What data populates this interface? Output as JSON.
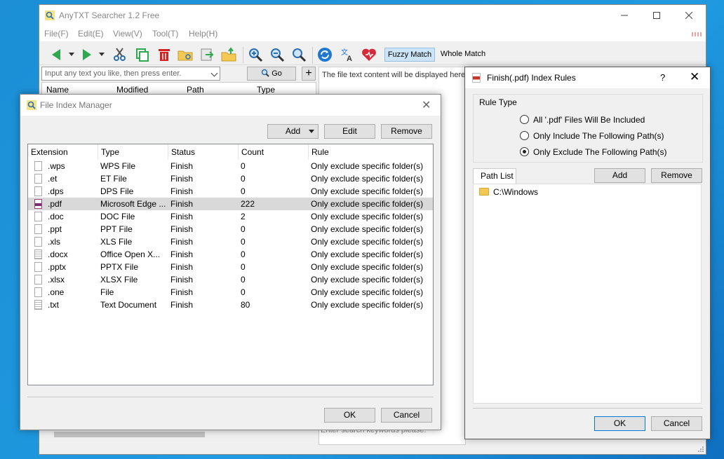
{
  "main": {
    "title": "AnyTXT Searcher 1.2 Free",
    "menu": [
      "File(F)",
      "Edit(E)",
      "View(V)",
      "Tool(T)",
      "Help(H)"
    ],
    "toolbar": {
      "fuzzy_label": "Fuzzy Match",
      "whole_label": "Whole Match"
    },
    "search": {
      "placeholder": "Input any text you like, then press enter.",
      "go_label": "Go",
      "plus_label": "+"
    },
    "results_columns": [
      "Name",
      "Modified",
      "Path",
      "Type"
    ],
    "preview_text": "The file text content will be displayed here",
    "keyword_placeholder": "Enter search keywords please."
  },
  "file_index_manager": {
    "title": "File Index Manager",
    "buttons": {
      "add": "Add",
      "edit": "Edit",
      "remove": "Remove",
      "ok": "OK",
      "cancel": "Cancel"
    },
    "columns": [
      "Extension",
      "Type",
      "Status",
      "Count",
      "Rule"
    ],
    "rows": [
      {
        "ext": ".wps",
        "type": "WPS File",
        "status": "Finish",
        "count": "0",
        "rule": "Only exclude specific folder(s)",
        "icon": "blank"
      },
      {
        "ext": ".et",
        "type": "ET File",
        "status": "Finish",
        "count": "0",
        "rule": "Only exclude specific folder(s)",
        "icon": "blank"
      },
      {
        "ext": ".dps",
        "type": "DPS File",
        "status": "Finish",
        "count": "0",
        "rule": "Only exclude specific folder(s)",
        "icon": "blank"
      },
      {
        "ext": ".pdf",
        "type": "Microsoft Edge ...",
        "status": "Finish",
        "count": "222",
        "rule": "Only exclude specific folder(s)",
        "icon": "pdf",
        "selected": true
      },
      {
        "ext": ".doc",
        "type": "DOC File",
        "status": "Finish",
        "count": "2",
        "rule": "Only exclude specific folder(s)",
        "icon": "blank"
      },
      {
        "ext": ".ppt",
        "type": "PPT File",
        "status": "Finish",
        "count": "0",
        "rule": "Only exclude specific folder(s)",
        "icon": "blank"
      },
      {
        "ext": ".xls",
        "type": "XLS File",
        "status": "Finish",
        "count": "0",
        "rule": "Only exclude specific folder(s)",
        "icon": "blank"
      },
      {
        "ext": ".docx",
        "type": "Office Open X...",
        "status": "Finish",
        "count": "0",
        "rule": "Only exclude specific folder(s)",
        "icon": "lined"
      },
      {
        "ext": ".pptx",
        "type": "PPTX File",
        "status": "Finish",
        "count": "0",
        "rule": "Only exclude specific folder(s)",
        "icon": "blank"
      },
      {
        "ext": ".xlsx",
        "type": "XLSX File",
        "status": "Finish",
        "count": "0",
        "rule": "Only exclude specific folder(s)",
        "icon": "blank"
      },
      {
        "ext": ".one",
        "type": "File",
        "status": "Finish",
        "count": "0",
        "rule": "Only exclude specific folder(s)",
        "icon": "blank"
      },
      {
        "ext": ".txt",
        "type": "Text Document",
        "status": "Finish",
        "count": "80",
        "rule": "Only exclude specific folder(s)",
        "icon": "lined"
      }
    ]
  },
  "index_rules": {
    "title": "Finish(.pdf) Index Rules",
    "help": "?",
    "rule_type_label": "Rule Type",
    "options": [
      {
        "label": "All '.pdf' Files Will Be Included",
        "checked": false
      },
      {
        "label": "Only Include The Following Path(s)",
        "checked": false
      },
      {
        "label": "Only Exclude The Following Path(s)",
        "checked": true
      }
    ],
    "path_list_tab": "Path List",
    "buttons": {
      "add": "Add",
      "remove": "Remove",
      "ok": "OK",
      "cancel": "Cancel"
    },
    "paths": [
      "C:\\Windows"
    ]
  },
  "colors": {
    "desktop": "#1f9ae0",
    "selected_row": "#d9d9d9",
    "fuzzy_active": "#cce4f7",
    "accent": "#0078d7"
  }
}
